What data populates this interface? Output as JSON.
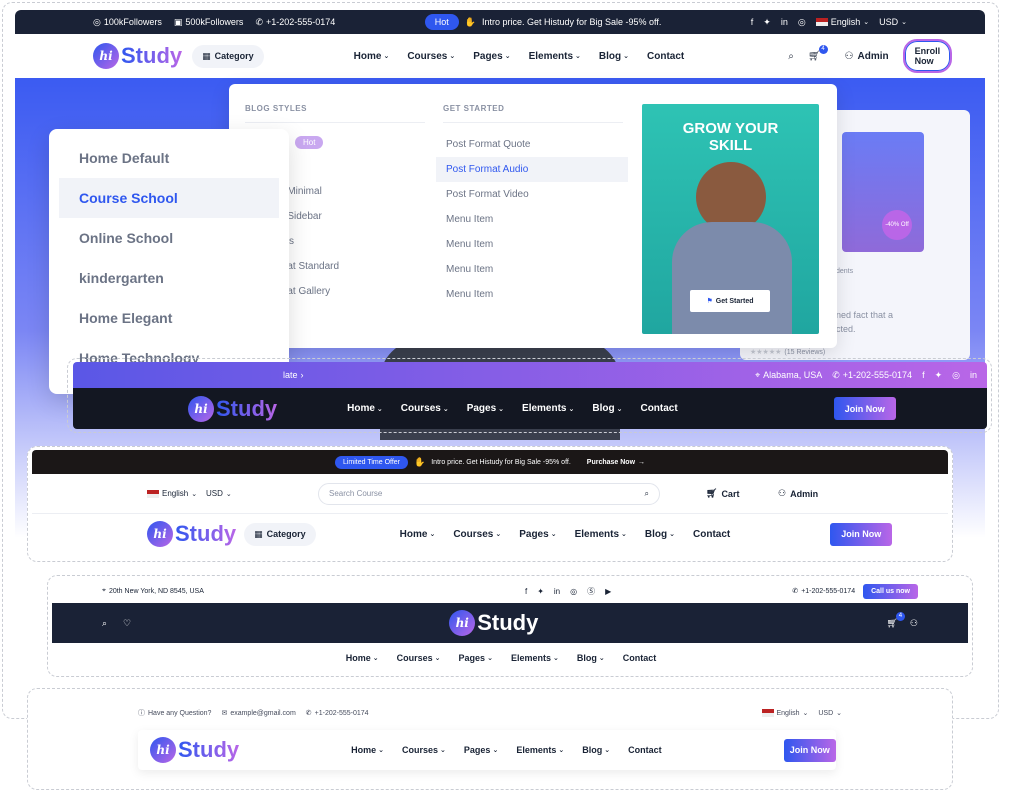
{
  "header1": {
    "followers1": "100kFollowers",
    "followers2": "500kFollowers",
    "phone": "+1-202-555-0174",
    "hot_badge": "Hot",
    "promo": "Intro price. Get Histudy for Big Sale -95% off.",
    "language": "English",
    "currency": "USD",
    "logo_text": "Study",
    "logo_mark": "hi",
    "category": "Category",
    "nav": [
      "Home",
      "Courses",
      "Pages",
      "Elements",
      "Blog",
      "Contact"
    ],
    "cart_count": "4",
    "admin": "Admin",
    "enroll": "Enroll Now"
  },
  "home_dropdown": {
    "items": [
      "Home Default",
      "Course School",
      "Online School",
      "kindergarten",
      "Home Elegant",
      "Home Technology"
    ],
    "active_index": 1
  },
  "mega_menu": {
    "col1_title": "BLOG STYLES",
    "col1_hot": "Hot",
    "col1_items": [
      "d",
      "d Minimal",
      "h Sidebar",
      "ails",
      "mat Standard",
      "mat Gallery"
    ],
    "col2_title": "GET STARTED",
    "col2_items": [
      "Post Format Quote",
      "Post Format Audio",
      "Post Format Video",
      "Menu Item",
      "Menu Item",
      "Menu Item",
      "Menu Item"
    ],
    "col2_active_index": 1,
    "promo_title": "GROW YOUR SKILL",
    "promo_button": "Get Started"
  },
  "bg_fragments": {
    "off_badge": "-40% Off",
    "students": "dents",
    "text1": "ned fact that a",
    "text2": "cted.",
    "reviews": "(15 Reviews)"
  },
  "header2": {
    "left_text": "late",
    "location": "Alabama, USA",
    "phone": "+1-202-555-0174",
    "nav": [
      "Home",
      "Courses",
      "Pages",
      "Elements",
      "Blog",
      "Contact"
    ],
    "join": "Join Now"
  },
  "header3": {
    "offer_badge": "Limited Time Offer",
    "promo": "Intro price. Get Histudy for Big Sale -95% off.",
    "purchase": "Purchase Now",
    "language": "English",
    "currency": "USD",
    "search_placeholder": "Search Course",
    "cart": "Cart",
    "admin": "Admin",
    "category": "Category",
    "nav": [
      "Home",
      "Courses",
      "Pages",
      "Elements",
      "Blog",
      "Contact"
    ],
    "join": "Join Now"
  },
  "header4": {
    "address": "20th New York, ND 8545, USA",
    "phone": "+1-202-555-0174",
    "call": "Call us now",
    "cart_count": "4",
    "nav": [
      "Home",
      "Courses",
      "Pages",
      "Elements",
      "Blog",
      "Contact"
    ]
  },
  "header5": {
    "question": "Have any Question?",
    "email": "example@gmail.com",
    "phone": "+1-202-555-0174",
    "language": "English",
    "currency": "USD",
    "nav": [
      "Home",
      "Courses",
      "Pages",
      "Elements",
      "Blog",
      "Contact"
    ],
    "join": "Join Now"
  },
  "colors": {
    "primary": "#2f57ef",
    "secondary": "#b966e7",
    "dark": "#1a2236"
  }
}
